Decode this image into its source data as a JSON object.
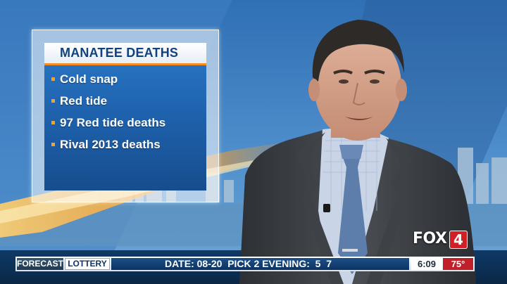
{
  "graphic": {
    "title": "MANATEE DEATHS",
    "bullets": [
      "Cold snap",
      "Red tide",
      "97 Red tide deaths",
      "Rival 2013 deaths"
    ]
  },
  "logo": {
    "network": "FOX",
    "channel": "4"
  },
  "ticker": {
    "tab_forecast": "FORECAST",
    "tab_lottery": "LOTTERY",
    "crawl": "DATE: 08-20  PICK 2 EVENING:  5  7",
    "time": "6:09",
    "temperature": "75°"
  },
  "colors": {
    "accent_orange": "#f58a1f",
    "graphic_blue": "#1d5fa9",
    "ticker_navy": "#0c3363",
    "temp_red": "#c0202a",
    "logo_red": "#d21f26"
  }
}
